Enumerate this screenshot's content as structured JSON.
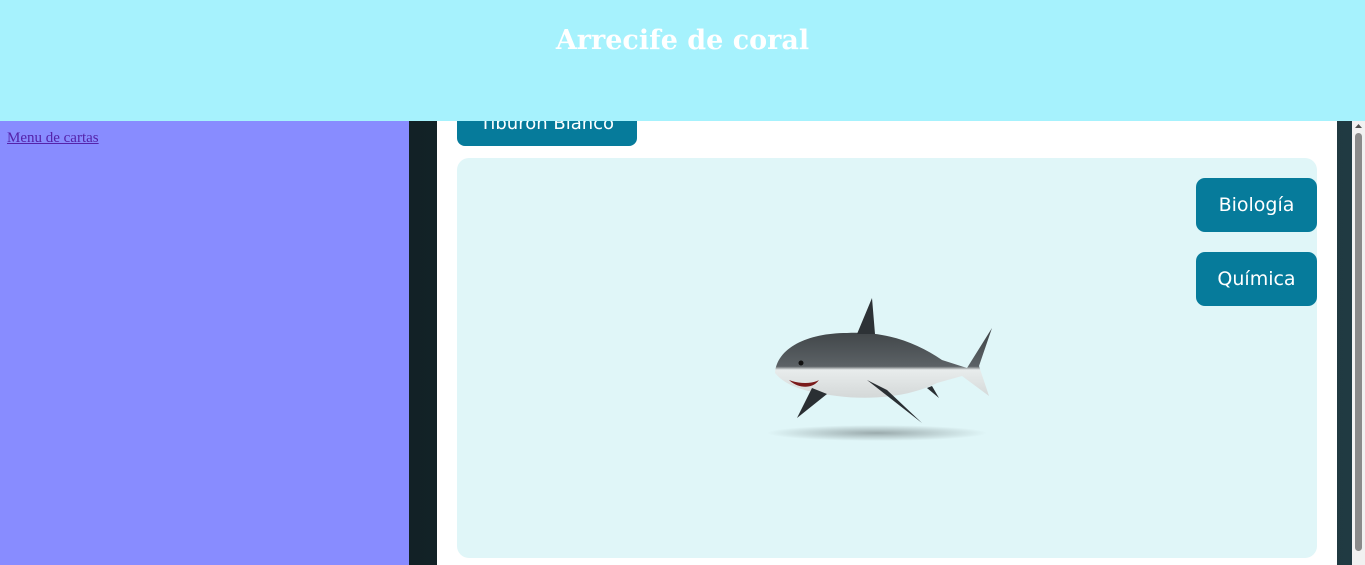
{
  "header": {
    "title": "Arrecife de coral"
  },
  "sidebar": {
    "menu_link": "Menu de cartas"
  },
  "card": {
    "title_button": "Tiburon Blanco",
    "buttons": {
      "biology": "Biología",
      "chemistry": "Química"
    }
  },
  "colors": {
    "header_bg": "#a6f2fd",
    "sidebar_bg": "#888cff",
    "button_bg": "#067b9b",
    "viewer_bg": "#e0f6f8"
  },
  "icons": {
    "model": "shark-3d-model",
    "scroll_up": "scroll-up-arrow"
  }
}
